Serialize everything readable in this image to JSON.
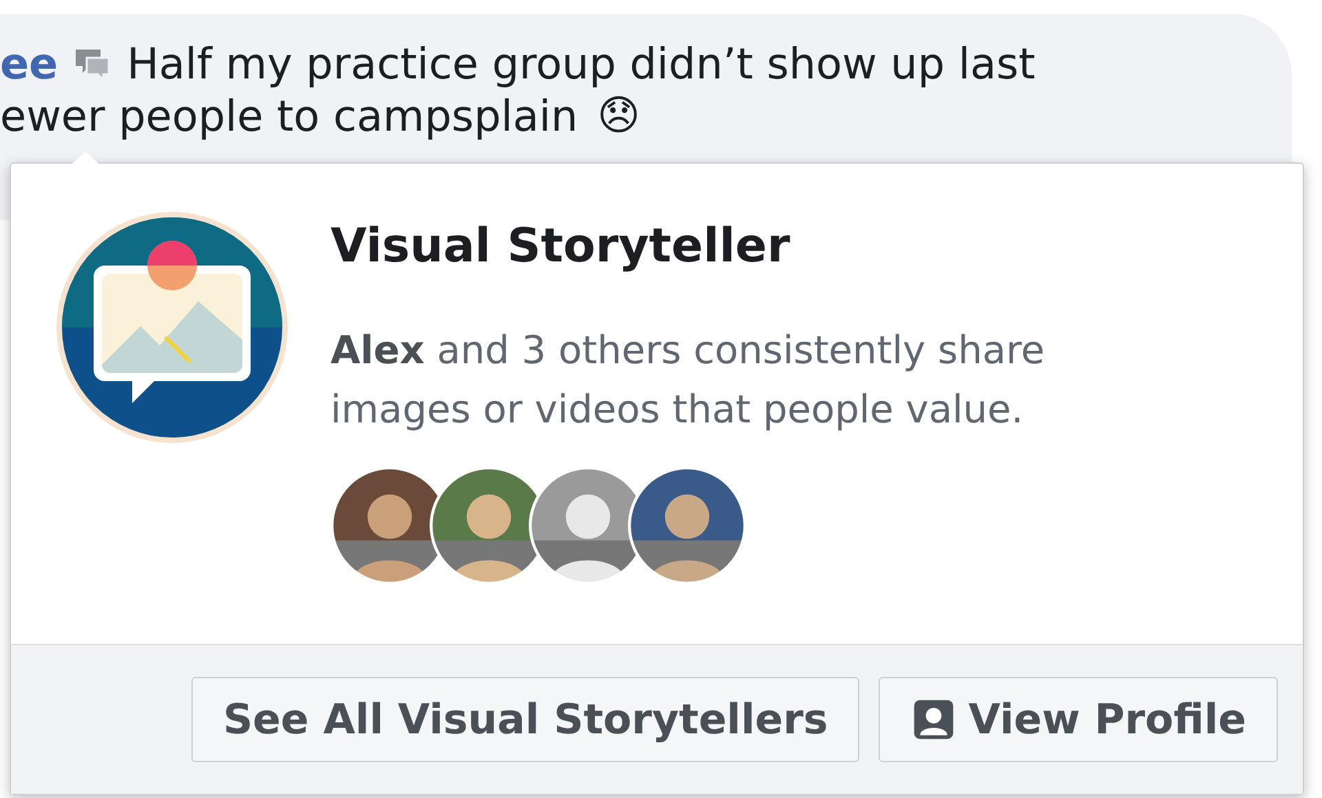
{
  "comment": {
    "author": "ee",
    "line_1": "Half my practice group didn’t show up last",
    "line_2": "ewer people to campsplain",
    "emoji": "😞"
  },
  "popover": {
    "title": "Visual Storyteller",
    "description": "**Alex** and 3 others consistently share images or videos that people value.",
    "buttons": [
      {
        "label": "See All Visual Storytellers",
        "kind": "plain"
      },
      {
        "label": "View Profile",
        "kind": "profile"
      }
    ]
  }
}
